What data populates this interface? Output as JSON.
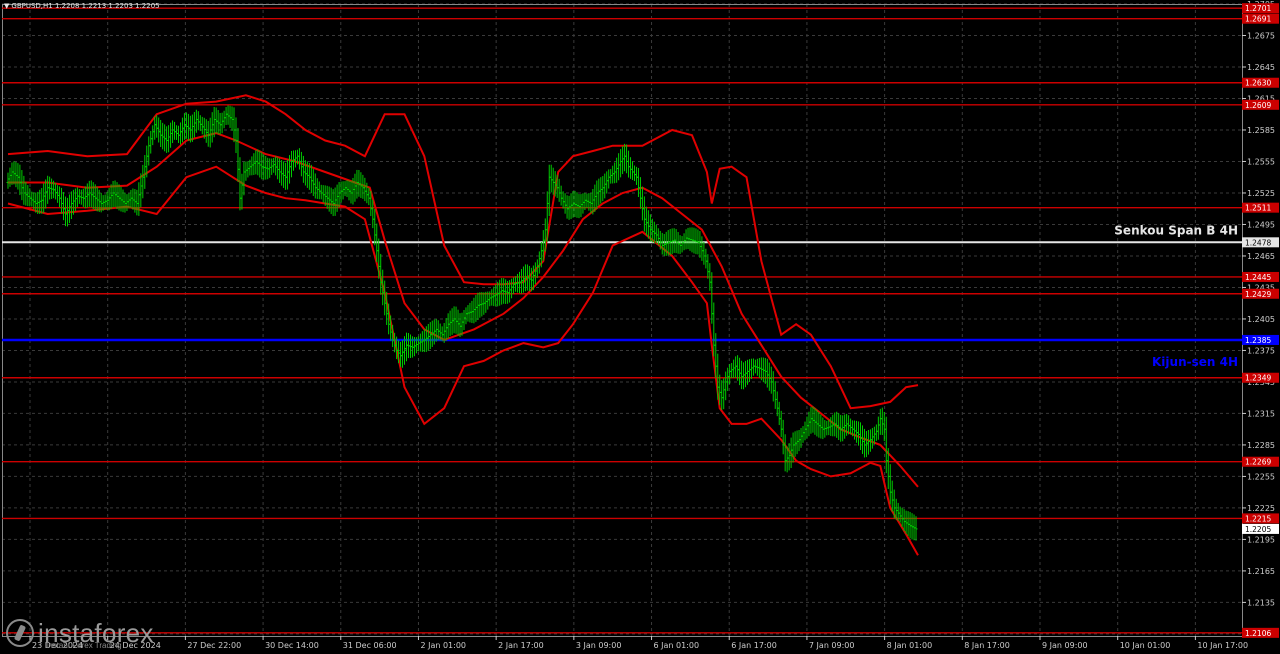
{
  "header": {
    "title": "GBPUSD,H1  1.2208 1.2213 1.2203 1.2205"
  },
  "colors": {
    "bg": "#000000",
    "grid": "#3a3a3a",
    "axis": "#cccccc",
    "candle": "#00cc00",
    "bands": "#e00000",
    "levels": "#cc0000",
    "senkou": "#e6e6e6",
    "kijun": "#0000ff"
  },
  "chart_data": {
    "type": "line",
    "symbol": "GBPUSD,H1",
    "ohlc_header": {
      "open": 1.2208,
      "high": 1.2213,
      "low": 1.2203,
      "close": 1.2205
    },
    "ylim": [
      1.2103,
      1.2705
    ],
    "y_ticks": [
      "1.2705",
      "1.2675",
      "1.2645",
      "1.2615",
      "1.2585",
      "1.2555",
      "1.2525",
      "1.2495",
      "1.2465",
      "1.2435",
      "1.2405",
      "1.2375",
      "1.2345",
      "1.2315",
      "1.2285",
      "1.2255",
      "1.2225",
      "1.2195",
      "1.2165",
      "1.2135",
      "1.2105"
    ],
    "x_ticks": [
      "23 Dec 2024",
      "24 Dec 2024",
      "27 Dec 22:00",
      "30 Dec 14:00",
      "31 Dec 06:00",
      "2 Jan 01:00",
      "2 Jan 17:00",
      "3 Jan 09:00",
      "6 Jan 01:00",
      "6 Jan 17:00",
      "7 Jan 09:00",
      "8 Jan 01:00",
      "8 Jan 17:00",
      "9 Jan 09:00",
      "10 Jan 01:00",
      "10 Jan 17:00"
    ],
    "price_series": [
      [
        0,
        1.2535
      ],
      [
        6,
        1.2545
      ],
      [
        12,
        1.254
      ],
      [
        18,
        1.2525
      ],
      [
        24,
        1.252
      ],
      [
        30,
        1.2515
      ],
      [
        36,
        1.2518
      ],
      [
        42,
        1.253
      ],
      [
        48,
        1.2528
      ],
      [
        54,
        1.252
      ],
      [
        60,
        1.2505
      ],
      [
        66,
        1.2515
      ],
      [
        72,
        1.2522
      ],
      [
        78,
        1.252
      ],
      [
        84,
        1.2525
      ],
      [
        90,
        1.252
      ],
      [
        96,
        1.2515
      ],
      [
        102,
        1.2518
      ],
      [
        108,
        1.2525
      ],
      [
        114,
        1.252
      ],
      [
        120,
        1.2515
      ],
      [
        126,
        1.252
      ],
      [
        132,
        1.2515
      ],
      [
        138,
        1.254
      ],
      [
        144,
        1.257
      ],
      [
        150,
        1.259
      ],
      [
        156,
        1.258
      ],
      [
        162,
        1.2575
      ],
      [
        168,
        1.2585
      ],
      [
        174,
        1.258
      ],
      [
        180,
        1.259
      ],
      [
        186,
        1.2585
      ],
      [
        192,
        1.2595
      ],
      [
        198,
        1.2588
      ],
      [
        204,
        1.258
      ],
      [
        210,
        1.2595
      ],
      [
        216,
        1.259
      ],
      [
        222,
        1.26
      ],
      [
        228,
        1.2595
      ],
      [
        232,
        1.2575
      ],
      [
        236,
        1.252
      ],
      [
        240,
        1.2545
      ],
      [
        246,
        1.255
      ],
      [
        252,
        1.2555
      ],
      [
        258,
        1.255
      ],
      [
        264,
        1.2548
      ],
      [
        270,
        1.2552
      ],
      [
        276,
        1.2545
      ],
      [
        282,
        1.254
      ],
      [
        288,
        1.2555
      ],
      [
        294,
        1.256
      ],
      [
        300,
        1.2545
      ],
      [
        306,
        1.254
      ],
      [
        312,
        1.253
      ],
      [
        318,
        1.2525
      ],
      [
        324,
        1.252
      ],
      [
        330,
        1.2515
      ],
      [
        336,
        1.2525
      ],
      [
        342,
        1.253
      ],
      [
        348,
        1.2525
      ],
      [
        354,
        1.2535
      ],
      [
        360,
        1.253
      ],
      [
        366,
        1.252
      ],
      [
        370,
        1.25
      ],
      [
        374,
        1.247
      ],
      [
        378,
        1.244
      ],
      [
        382,
        1.242
      ],
      [
        386,
        1.24
      ],
      [
        390,
        1.2385
      ],
      [
        394,
        1.2375
      ],
      [
        398,
        1.237
      ],
      [
        404,
        1.238
      ],
      [
        410,
        1.2378
      ],
      [
        416,
        1.2382
      ],
      [
        422,
        1.2385
      ],
      [
        428,
        1.239
      ],
      [
        434,
        1.2395
      ],
      [
        440,
        1.239
      ],
      [
        446,
        1.24
      ],
      [
        452,
        1.2405
      ],
      [
        458,
        1.2398
      ],
      [
        464,
        1.241
      ],
      [
        470,
        1.2412
      ],
      [
        476,
        1.2418
      ],
      [
        482,
        1.242
      ],
      [
        488,
        1.2425
      ],
      [
        494,
        1.2428
      ],
      [
        500,
        1.2432
      ],
      [
        506,
        1.243
      ],
      [
        512,
        1.2438
      ],
      [
        518,
        1.244
      ],
      [
        524,
        1.2445
      ],
      [
        530,
        1.2442
      ],
      [
        536,
        1.2455
      ],
      [
        540,
        1.247
      ],
      [
        544,
        1.249
      ],
      [
        548,
        1.254
      ],
      [
        552,
        1.2535
      ],
      [
        556,
        1.253
      ],
      [
        560,
        1.252
      ],
      [
        566,
        1.251
      ],
      [
        572,
        1.2515
      ],
      [
        578,
        1.2512
      ],
      [
        584,
        1.2518
      ],
      [
        590,
        1.2515
      ],
      [
        596,
        1.2525
      ],
      [
        602,
        1.253
      ],
      [
        608,
        1.254
      ],
      [
        614,
        1.2545
      ],
      [
        620,
        1.2555
      ],
      [
        624,
        1.256
      ],
      [
        628,
        1.255
      ],
      [
        632,
        1.2545
      ],
      [
        636,
        1.254
      ],
      [
        640,
        1.252
      ],
      [
        644,
        1.25
      ],
      [
        650,
        1.249
      ],
      [
        656,
        1.2485
      ],
      [
        662,
        1.2475
      ],
      [
        668,
        1.2478
      ],
      [
        674,
        1.248
      ],
      [
        680,
        1.2475
      ],
      [
        686,
        1.2482
      ],
      [
        692,
        1.248
      ],
      [
        698,
        1.2478
      ],
      [
        702,
        1.247
      ],
      [
        706,
        1.246
      ],
      [
        710,
        1.244
      ],
      [
        714,
        1.238
      ],
      [
        718,
        1.234
      ],
      [
        722,
        1.233
      ],
      [
        726,
        1.2345
      ],
      [
        730,
        1.2355
      ],
      [
        736,
        1.236
      ],
      [
        742,
        1.235
      ],
      [
        748,
        1.2355
      ],
      [
        754,
        1.236
      ],
      [
        760,
        1.2358
      ],
      [
        766,
        1.2355
      ],
      [
        772,
        1.2345
      ],
      [
        778,
        1.232
      ],
      [
        782,
        1.23
      ],
      [
        786,
        1.227
      ],
      [
        790,
        1.2275
      ],
      [
        794,
        1.2285
      ],
      [
        800,
        1.229
      ],
      [
        806,
        1.23
      ],
      [
        812,
        1.231
      ],
      [
        818,
        1.2305
      ],
      [
        824,
        1.23
      ],
      [
        830,
        1.2302
      ],
      [
        836,
        1.2305
      ],
      [
        842,
        1.23
      ],
      [
        848,
        1.2305
      ],
      [
        854,
        1.23
      ],
      [
        860,
        1.2295
      ],
      [
        866,
        1.2285
      ],
      [
        872,
        1.229
      ],
      [
        878,
        1.2298
      ],
      [
        882,
        1.231
      ],
      [
        886,
        1.23
      ],
      [
        888,
        1.227
      ],
      [
        892,
        1.224
      ],
      [
        896,
        1.2225
      ],
      [
        900,
        1.222
      ],
      [
        906,
        1.2212
      ],
      [
        912,
        1.2208
      ],
      [
        918,
        1.2205
      ]
    ],
    "bollinger_upper": [
      [
        0,
        1.2562
      ],
      [
        40,
        1.2565
      ],
      [
        80,
        1.256
      ],
      [
        120,
        1.2562
      ],
      [
        150,
        1.26
      ],
      [
        180,
        1.261
      ],
      [
        210,
        1.2612
      ],
      [
        240,
        1.2618
      ],
      [
        260,
        1.2612
      ],
      [
        280,
        1.26
      ],
      [
        300,
        1.2585
      ],
      [
        320,
        1.2575
      ],
      [
        340,
        1.257
      ],
      [
        360,
        1.256
      ],
      [
        380,
        1.26
      ],
      [
        400,
        1.26
      ],
      [
        420,
        1.256
      ],
      [
        440,
        1.2475
      ],
      [
        460,
        1.244
      ],
      [
        480,
        1.2438
      ],
      [
        500,
        1.2438
      ],
      [
        520,
        1.244
      ],
      [
        540,
        1.246
      ],
      [
        555,
        1.2545
      ],
      [
        570,
        1.256
      ],
      [
        590,
        1.2565
      ],
      [
        610,
        1.257
      ],
      [
        640,
        1.257
      ],
      [
        670,
        1.2585
      ],
      [
        690,
        1.258
      ],
      [
        705,
        1.2545
      ],
      [
        710,
        1.2515
      ],
      [
        718,
        1.2548
      ],
      [
        730,
        1.255
      ],
      [
        745,
        1.254
      ],
      [
        760,
        1.246
      ],
      [
        780,
        1.239
      ],
      [
        795,
        1.24
      ],
      [
        810,
        1.239
      ],
      [
        830,
        1.236
      ],
      [
        850,
        1.232
      ],
      [
        870,
        1.2322
      ],
      [
        890,
        1.2326
      ],
      [
        906,
        1.234
      ],
      [
        918,
        1.2342
      ]
    ],
    "bollinger_lower": [
      [
        0,
        1.2515
      ],
      [
        40,
        1.2505
      ],
      [
        80,
        1.2508
      ],
      [
        120,
        1.2512
      ],
      [
        150,
        1.2505
      ],
      [
        180,
        1.254
      ],
      [
        210,
        1.255
      ],
      [
        240,
        1.2532
      ],
      [
        260,
        1.2525
      ],
      [
        280,
        1.252
      ],
      [
        300,
        1.2518
      ],
      [
        320,
        1.2515
      ],
      [
        340,
        1.2512
      ],
      [
        360,
        1.25
      ],
      [
        380,
        1.243
      ],
      [
        400,
        1.234
      ],
      [
        420,
        1.2305
      ],
      [
        440,
        1.232
      ],
      [
        460,
        1.236
      ],
      [
        480,
        1.2365
      ],
      [
        500,
        1.2375
      ],
      [
        520,
        1.2382
      ],
      [
        540,
        1.2378
      ],
      [
        555,
        1.2382
      ],
      [
        570,
        1.24
      ],
      [
        590,
        1.243
      ],
      [
        610,
        1.2475
      ],
      [
        640,
        1.2488
      ],
      [
        670,
        1.2465
      ],
      [
        690,
        1.244
      ],
      [
        705,
        1.242
      ],
      [
        710,
        1.238
      ],
      [
        718,
        1.232
      ],
      [
        730,
        1.2305
      ],
      [
        745,
        1.2305
      ],
      [
        760,
        1.231
      ],
      [
        780,
        1.229
      ],
      [
        795,
        1.227
      ],
      [
        810,
        1.2262
      ],
      [
        830,
        1.2255
      ],
      [
        850,
        1.2258
      ],
      [
        870,
        1.2268
      ],
      [
        880,
        1.2265
      ],
      [
        890,
        1.2225
      ],
      [
        906,
        1.22
      ],
      [
        918,
        1.218
      ]
    ],
    "bollinger_mid": [
      [
        0,
        1.2535
      ],
      [
        40,
        1.2535
      ],
      [
        80,
        1.253
      ],
      [
        120,
        1.2532
      ],
      [
        150,
        1.255
      ],
      [
        180,
        1.2575
      ],
      [
        210,
        1.2582
      ],
      [
        230,
        1.2575
      ],
      [
        260,
        1.2562
      ],
      [
        290,
        1.2555
      ],
      [
        320,
        1.2545
      ],
      [
        350,
        1.2535
      ],
      [
        365,
        1.253
      ],
      [
        380,
        1.248
      ],
      [
        400,
        1.242
      ],
      [
        420,
        1.2395
      ],
      [
        440,
        1.2385
      ],
      [
        470,
        1.2395
      ],
      [
        500,
        1.241
      ],
      [
        520,
        1.2425
      ],
      [
        540,
        1.2445
      ],
      [
        560,
        1.247
      ],
      [
        580,
        1.25
      ],
      [
        600,
        1.2515
      ],
      [
        620,
        1.2525
      ],
      [
        640,
        1.253
      ],
      [
        660,
        1.252
      ],
      [
        680,
        1.2505
      ],
      [
        700,
        1.249
      ],
      [
        720,
        1.2455
      ],
      [
        740,
        1.241
      ],
      [
        760,
        1.238
      ],
      [
        780,
        1.235
      ],
      [
        800,
        1.233
      ],
      [
        820,
        1.2315
      ],
      [
        840,
        1.23
      ],
      [
        860,
        1.2292
      ],
      [
        880,
        1.2285
      ],
      [
        900,
        1.2265
      ],
      [
        918,
        1.2245
      ]
    ],
    "horizontal_levels": [
      {
        "value": 1.2701,
        "label": "1.2701"
      },
      {
        "value": 1.2691,
        "label": "1.2691"
      },
      {
        "value": 1.263,
        "label": "1.2630"
      },
      {
        "value": 1.2609,
        "label": "1.2609"
      },
      {
        "value": 1.2511,
        "label": "1.2511"
      },
      {
        "value": 1.2445,
        "label": "1.2445"
      },
      {
        "value": 1.2429,
        "label": "1.2429"
      },
      {
        "value": 1.2349,
        "label": "1.2349"
      },
      {
        "value": 1.2269,
        "label": "1.2269"
      },
      {
        "value": 1.2215,
        "label": "1.2215"
      },
      {
        "value": 1.2106,
        "label": "1.2106"
      }
    ],
    "senkou_span_b": {
      "value": 1.2478,
      "label": "1.2478",
      "name": "Senkou Span B 4H"
    },
    "kijun_sen": {
      "value": 1.2385,
      "label": "1.2385",
      "name": "Kijun-sen 4H"
    },
    "current_price": {
      "value": 1.2205,
      "label": "1.2205"
    },
    "grid": true
  },
  "watermark": {
    "brand": "instaforex",
    "tagline": "Instant Forex Trading"
  }
}
